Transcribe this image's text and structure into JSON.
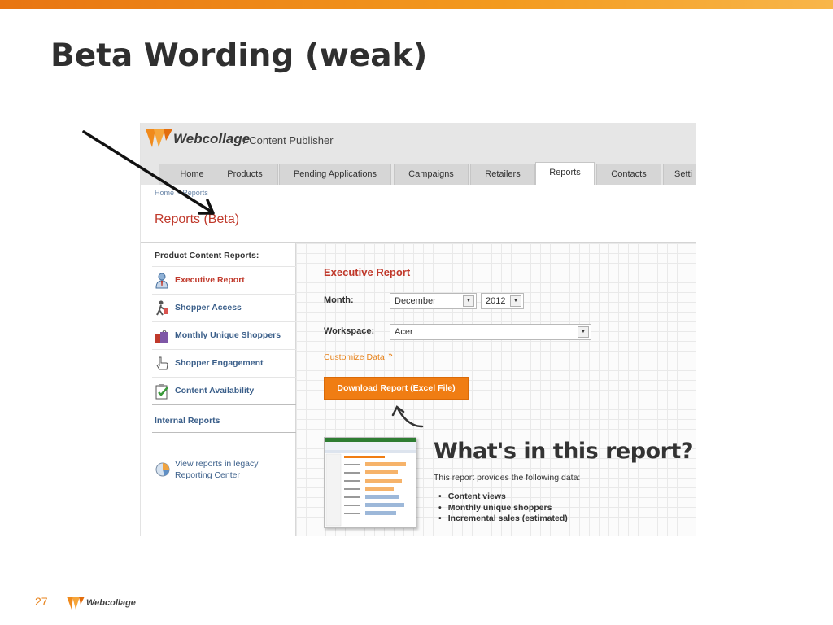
{
  "slide": {
    "title": "Beta Wording (weak)",
    "page_number": "27"
  },
  "footer": {
    "brand": "Webcollage"
  },
  "app": {
    "brand": "Webcollage",
    "product": "/ Content Publisher",
    "tabs": [
      "Home",
      "Products",
      "Pending Applications",
      "Campaigns",
      "Retailers",
      "Reports",
      "Contacts",
      "Setti"
    ],
    "active_tab": "Reports",
    "breadcrumb": "Home > Reports",
    "page_title": "Reports (Beta)"
  },
  "sidebar": {
    "section_title": "Product Content Reports:",
    "items": [
      {
        "label": "Executive Report",
        "icon": "person-icon"
      },
      {
        "label": "Shopper Access",
        "icon": "walking-shopper-icon"
      },
      {
        "label": "Monthly Unique Shoppers",
        "icon": "shopping-bags-icon"
      },
      {
        "label": "Shopper Engagement",
        "icon": "pointing-hand-icon"
      },
      {
        "label": "Content Availability",
        "icon": "clipboard-check-icon"
      }
    ],
    "internal_reports": "Internal Reports",
    "legacy_link": "View reports in legacy Reporting Center"
  },
  "report": {
    "title": "Executive Report",
    "month_label": "Month:",
    "month_value": "December",
    "year_value": "2012",
    "workspace_label": "Workspace:",
    "workspace_value": "Acer",
    "customize_link": "Customize Data",
    "download_button": "Download Report (Excel File)",
    "whats_heading": "What's in this report?",
    "provides_text": "This report provides the following data:",
    "bullets": [
      "Content views",
      "Monthly unique shoppers",
      "Incremental sales (estimated)"
    ]
  },
  "colors": {
    "accent": "#f07d13",
    "heading_red": "#c0392b",
    "link_blue": "#3b5f8a"
  }
}
